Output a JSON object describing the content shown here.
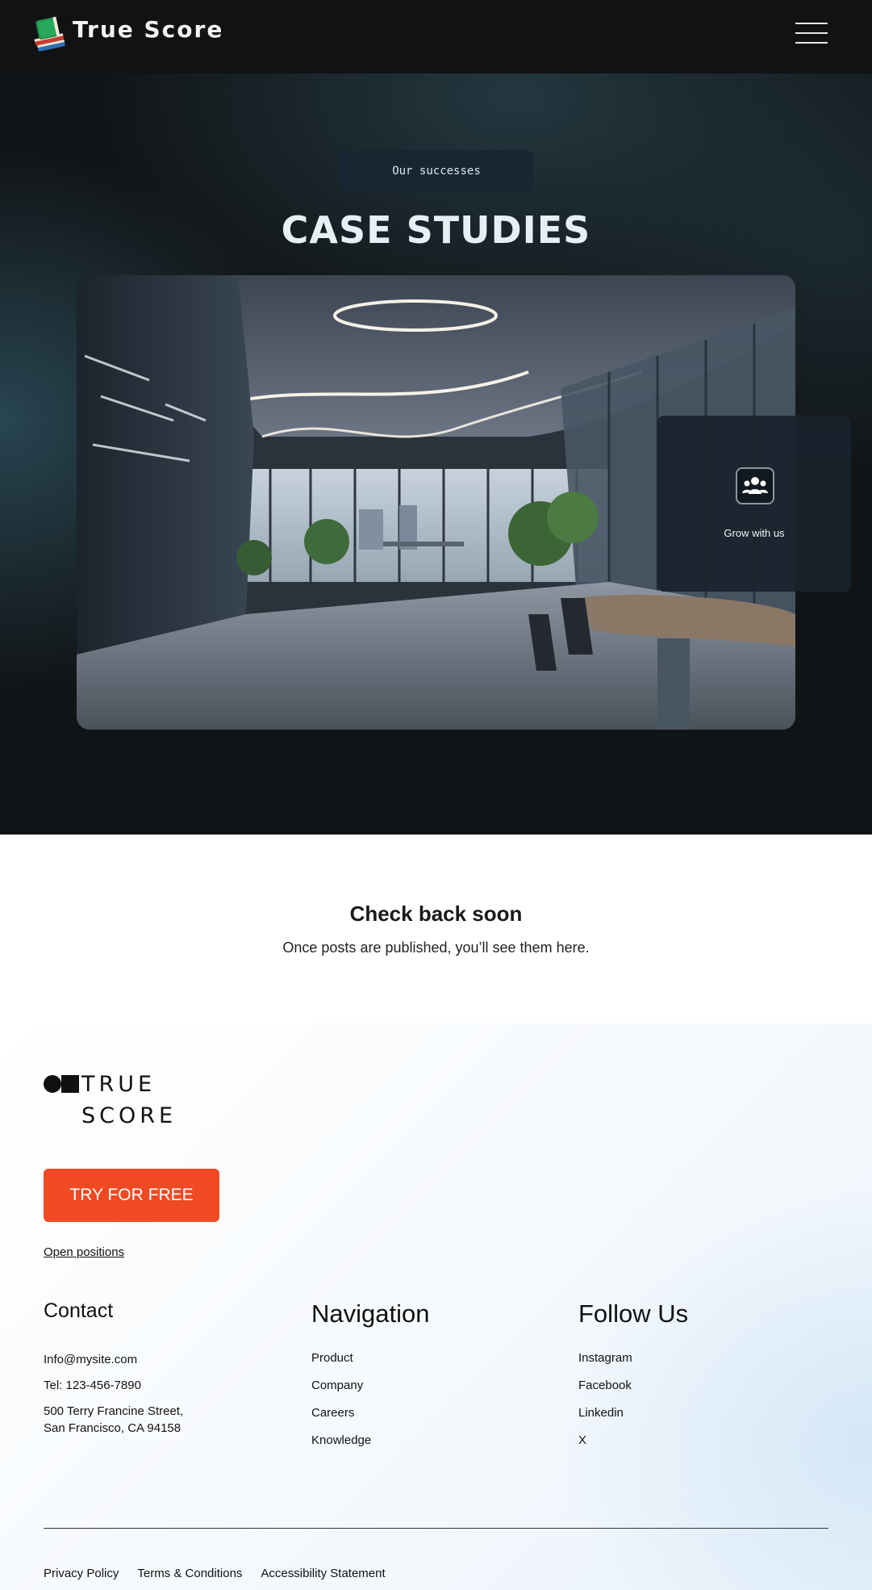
{
  "header": {
    "brand": "True Score",
    "logo_icon": "books-icon",
    "menu_icon": "hamburger-icon"
  },
  "hero": {
    "eyebrow": "Our successes",
    "title": "CASE STUDIES",
    "card": {
      "icon": "team-icon",
      "label": "Grow with us"
    }
  },
  "blog": {
    "empty_title": "Check back soon",
    "empty_subtitle": "Once posts are published, you’ll see them here."
  },
  "footer": {
    "logo_line1": "TRUE",
    "logo_line2": "SCORE",
    "cta_label": "TRY FOR FREE",
    "open_positions": "Open positions",
    "contact": {
      "heading": "Contact",
      "email": "Info@mysite.com",
      "phone": "Tel: 123-456-7890",
      "address_line1": "500 Terry Francine Street,",
      "address_line2": "San Francisco, CA 94158"
    },
    "navigation": {
      "heading": "Navigation",
      "items": [
        "Product",
        "Company",
        "Careers",
        "Knowledge"
      ]
    },
    "follow": {
      "heading": "Follow Us",
      "items": [
        "Instagram",
        "Facebook",
        "Linkedin",
        "X"
      ]
    },
    "legal": [
      "Privacy Policy",
      "Terms & Conditions",
      "Accessibility Statement"
    ]
  },
  "colors": {
    "hero_background": "#111416",
    "cta": "#f04a24",
    "pill": "#172633"
  }
}
